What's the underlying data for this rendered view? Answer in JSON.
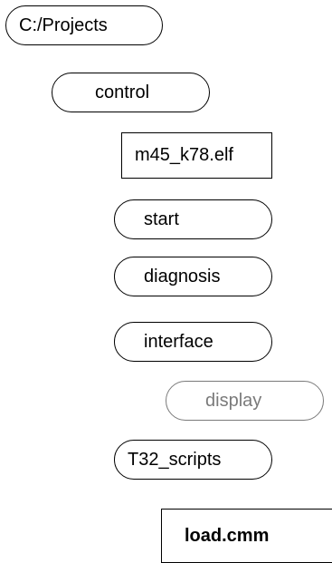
{
  "tree": {
    "root": "C:/Projects",
    "control": "control",
    "elf": "m45_k78.elf",
    "start": "start",
    "diagnosis": "diagnosis",
    "interface": "interface",
    "display": "display",
    "t32_scripts": "T32_scripts",
    "load": "load.cmm"
  },
  "colors": {
    "stroke": "#000000",
    "dimmed": "#7a7a7a",
    "background": "#ffffff"
  }
}
